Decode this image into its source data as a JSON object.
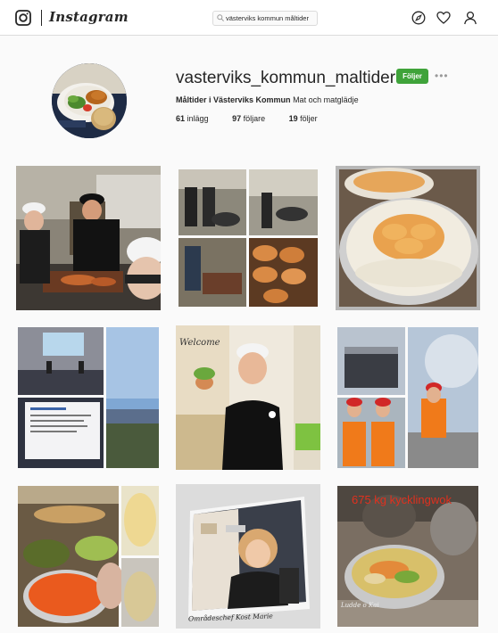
{
  "header": {
    "brand": "Instagram",
    "search_value": "västerviks kommun måltider"
  },
  "profile": {
    "username": "vasterviks_kommun_maltider",
    "follow_label": "Följer",
    "more_label": "•••",
    "full_name": "Måltider i Västerviks Kommun",
    "bio": "Mat och matglädje",
    "stats": {
      "posts_count": "61",
      "posts_label": "inlägg",
      "followers_count": "97",
      "followers_label": "följare",
      "following_count": "19",
      "following_label": "följer"
    }
  },
  "posts": {
    "p4_slide_title": "Welcome",
    "p8_caption": "Områdeschef Kost Marie",
    "p9_title": "675 kg kycklingwok",
    "p9_sign": "Ludde o Kai"
  },
  "colors": {
    "follow_green": "#3fa33a",
    "text": "#262626",
    "background": "#fafafa"
  }
}
